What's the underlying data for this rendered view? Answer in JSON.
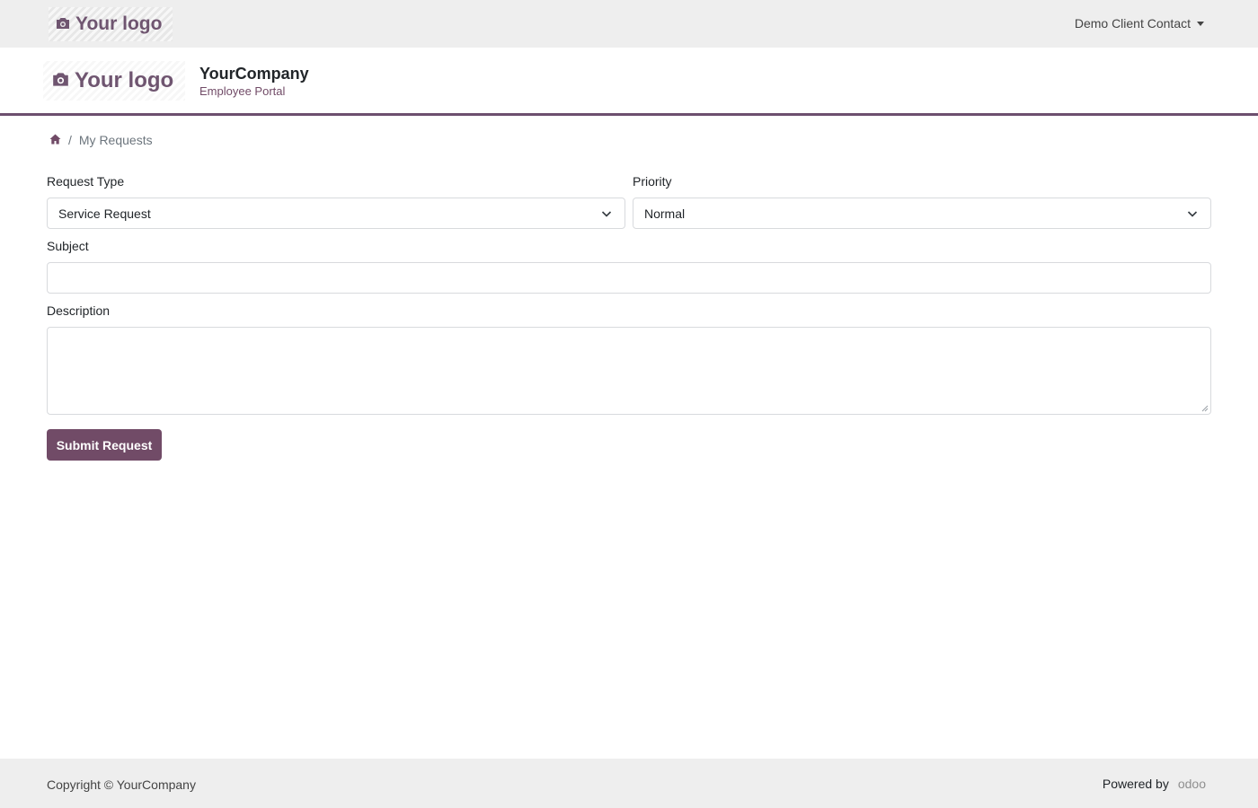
{
  "topbar": {
    "logo_text": "Your logo",
    "user_name": "Demo Client Contact"
  },
  "header": {
    "logo_text": "Your logo",
    "company_name": "YourCompany",
    "company_subtitle": "Employee Portal"
  },
  "breadcrumb": {
    "home_icon": "home-icon",
    "separator": "/",
    "current": "My Requests"
  },
  "form": {
    "request_type_label": "Request Type",
    "request_type_value": "Service Request",
    "priority_label": "Priority",
    "priority_value": "Normal",
    "subject_label": "Subject",
    "subject_value": "",
    "description_label": "Description",
    "description_value": "",
    "submit_label": "Submit Request"
  },
  "footer": {
    "copyright": "Copyright © YourCompany",
    "powered_by": "Powered by",
    "brand": "odoo"
  },
  "colors": {
    "accent": "#714b67",
    "topbar_bg": "#eeeeee",
    "footer_bg": "#eeeeee"
  }
}
